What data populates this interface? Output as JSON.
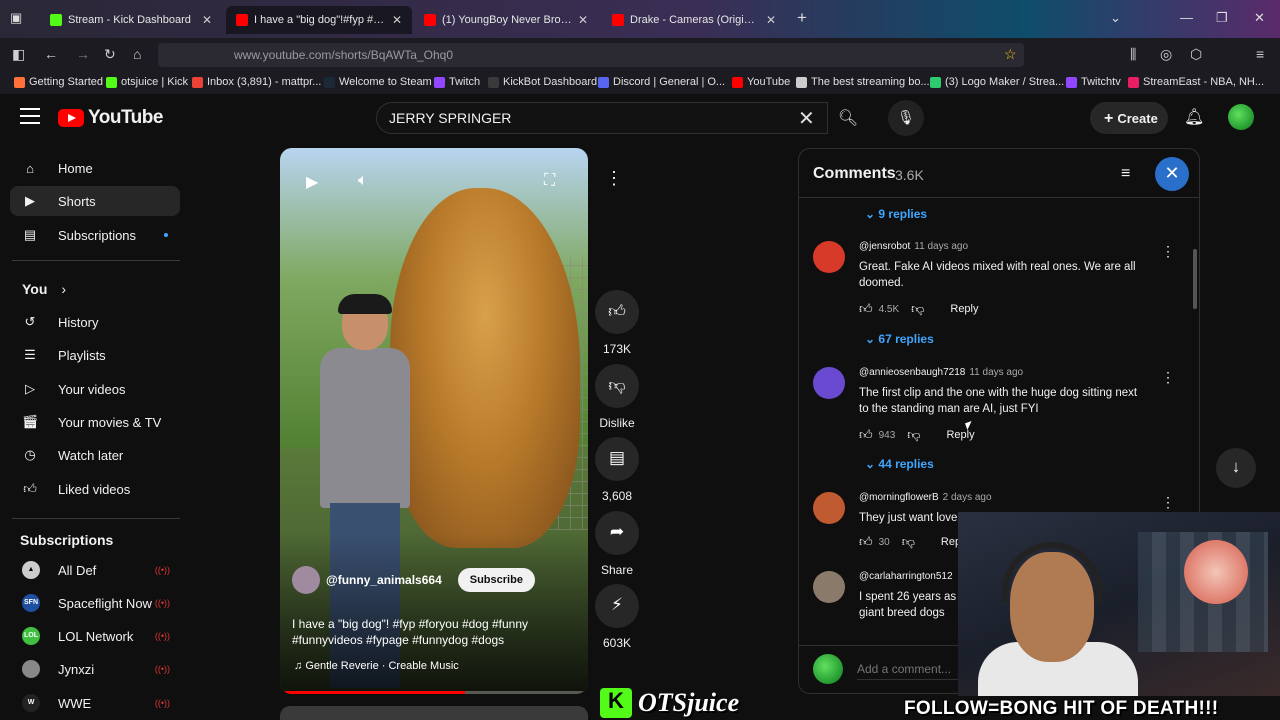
{
  "browser": {
    "tabs": [
      {
        "title": "Stream - Kick Dashboard",
        "color": "#53fc18"
      },
      {
        "title": "I have a \"big dog\"!#fyp #foryo",
        "color": "#ff0000"
      },
      {
        "title": "(1) YoungBoy Never Broke Agai",
        "color": "#ff0000"
      },
      {
        "title": "Drake - Cameras (Original CDQ",
        "color": "#ff0000"
      }
    ],
    "url": "www.youtube.com/shorts/BqAWTa_Ohq0",
    "bookmarks": [
      "Getting Started",
      "otsjuice | Kick",
      "Inbox (3,891) - mattpr...",
      "Welcome to Steam",
      "Twitch",
      "KickBot Dashboard",
      "Discord | General | O...",
      "YouTube",
      "The best streaming bo...",
      "(3) Logo Maker / Strea...",
      "Twitchtv",
      "StreamEast - NBA, NH..."
    ]
  },
  "header": {
    "logo_text": "YouTube",
    "search_value": "JERRY SPRINGER",
    "create_label": "Create"
  },
  "sidebar": {
    "main": [
      {
        "label": "Home",
        "icon": "home-icon"
      },
      {
        "label": "Shorts",
        "icon": "shorts-icon"
      },
      {
        "label": "Subscriptions",
        "icon": "subscriptions-icon"
      }
    ],
    "you_header": "You",
    "you_items": [
      {
        "label": "History",
        "icon": "history-icon"
      },
      {
        "label": "Playlists",
        "icon": "playlists-icon"
      },
      {
        "label": "Your videos",
        "icon": "your-videos-icon"
      },
      {
        "label": "Your movies & TV",
        "icon": "movies-icon"
      },
      {
        "label": "Watch later",
        "icon": "clock-icon"
      },
      {
        "label": "Liked videos",
        "icon": "thumbs-up-icon"
      }
    ],
    "subs_header": "Subscriptions",
    "subs": [
      {
        "label": "All Def",
        "color": "#cccccc"
      },
      {
        "label": "Spaceflight Now",
        "color": "#1e4fa0"
      },
      {
        "label": "LOL Network",
        "color": "#3fbf3f"
      },
      {
        "label": "Jynxzi",
        "color": "#888888"
      },
      {
        "label": "WWE",
        "color": "#222222"
      }
    ]
  },
  "short": {
    "channel": "@funny_animals664",
    "subscribe_label": "Subscribe",
    "title": "I have a \"big dog\"! #fyp #foryou #dog #funny #funnyvideos #fypage #funnydog #dogs",
    "music": "Gentle Reverie · Creable Music",
    "progress": 0.6
  },
  "actions": {
    "likes": "173K",
    "dislike_label": "Dislike",
    "comments": "3,608",
    "share_label": "Share",
    "remix": "603K"
  },
  "comments_panel": {
    "title": "Comments",
    "count": "3.6K",
    "top_replies": "9 replies",
    "items": [
      {
        "author": "@jensrobot",
        "time": "11 days ago",
        "text": "Great. Fake AI videos mixed with real ones. We are all doomed.",
        "likes": "4.5K",
        "reply_label": "Reply",
        "replies": "67 replies",
        "avatar_color": "#d83a2a"
      },
      {
        "author": "@annieosenbaugh7218",
        "time": "11 days ago",
        "text": "The first clip and the one with the huge dog sitting next to the standing man are AI, just FYI",
        "likes": "943",
        "reply_label": "Reply",
        "replies": "44 replies",
        "avatar_color": "#6a4ad0"
      },
      {
        "author": "@morningflowerB",
        "time": "2 days ago",
        "text": "They just want love",
        "likes": "30",
        "reply_label": "Reply",
        "avatar_color": "#c05a30"
      },
      {
        "author": "@carlaharrington512",
        "time": "",
        "text": "I spent 26 years as in giant breed dogs",
        "avatar_color": "#8a7a6a"
      }
    ],
    "add_placeholder": "Add a comment..."
  },
  "overlay": {
    "brand": "OTSjuice",
    "follow_text": "FOLLOW=BONG HIT OF DEATH!!!"
  }
}
